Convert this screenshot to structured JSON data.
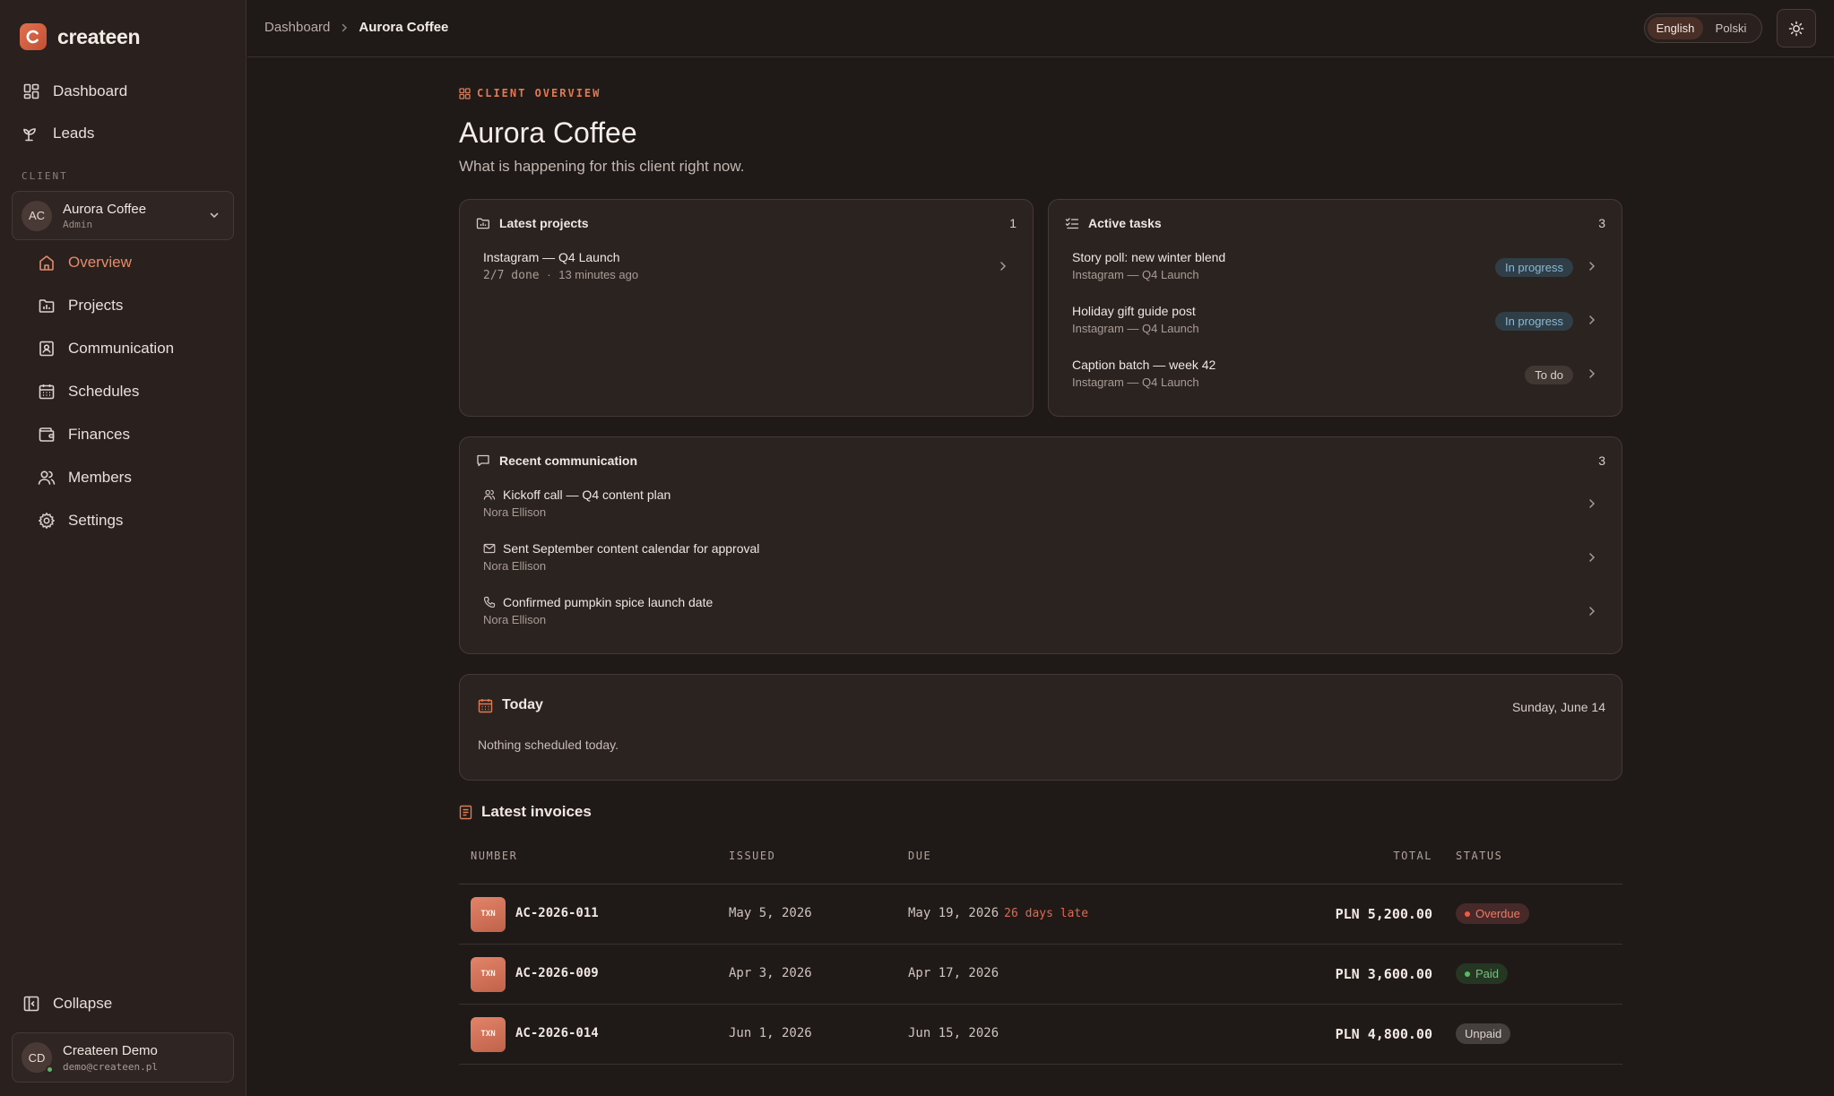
{
  "brand": {
    "name": "createen"
  },
  "nav": {
    "top": [
      {
        "label": "Dashboard",
        "icon": "dashboard-icon"
      },
      {
        "label": "Leads",
        "icon": "sprout-icon"
      }
    ],
    "section_label": "CLIENT",
    "client": {
      "initials": "AC",
      "name": "Aurora Coffee",
      "role": "Admin"
    },
    "sub": [
      {
        "label": "Overview",
        "icon": "home-icon",
        "active": true
      },
      {
        "label": "Projects",
        "icon": "folder-icon"
      },
      {
        "label": "Communication",
        "icon": "contact-icon"
      },
      {
        "label": "Schedules",
        "icon": "calendar-icon"
      },
      {
        "label": "Finances",
        "icon": "wallet-icon"
      },
      {
        "label": "Members",
        "icon": "users-icon"
      },
      {
        "label": "Settings",
        "icon": "gear-icon"
      }
    ],
    "collapse_label": "Collapse",
    "user": {
      "initials": "CD",
      "name": "Createen Demo",
      "email": "demo@createen.pl"
    }
  },
  "topbar": {
    "breadcrumb": [
      "Dashboard",
      "Aurora Coffee"
    ],
    "languages": [
      "English",
      "Polski"
    ],
    "active_language": "English"
  },
  "page": {
    "eyebrow": "CLIENT OVERVIEW",
    "title": "Aurora Coffee",
    "subtitle": "What is happening for this client right now."
  },
  "projects": {
    "title": "Latest projects",
    "count": "1",
    "items": [
      {
        "name": "Instagram — Q4 Launch",
        "progress": "2/7 done",
        "sep": "·",
        "time": "13 minutes ago"
      }
    ]
  },
  "tasks": {
    "title": "Active tasks",
    "count": "3",
    "items": [
      {
        "name": "Story poll: new winter blend",
        "project": "Instagram — Q4 Launch",
        "status": "In progress"
      },
      {
        "name": "Holiday gift guide post",
        "project": "Instagram — Q4 Launch",
        "status": "In progress"
      },
      {
        "name": "Caption batch — week 42",
        "project": "Instagram — Q4 Launch",
        "status": "To do"
      }
    ]
  },
  "communication": {
    "title": "Recent communication",
    "count": "3",
    "items": [
      {
        "icon": "people-icon",
        "title": "Kickoff call — Q4 content plan",
        "person": "Nora Ellison"
      },
      {
        "icon": "mail-icon",
        "title": "Sent September content calendar for approval",
        "person": "Nora Ellison"
      },
      {
        "icon": "phone-icon",
        "title": "Confirmed pumpkin spice launch date",
        "person": "Nora Ellison"
      }
    ]
  },
  "today": {
    "title": "Today",
    "date": "Sunday, June 14",
    "empty": "Nothing scheduled today."
  },
  "invoices": {
    "title": "Latest invoices",
    "columns": {
      "number": "NUMBER",
      "issued": "ISSUED",
      "due": "DUE",
      "total": "TOTAL",
      "status": "STATUS"
    },
    "rows": [
      {
        "tag": "TXN",
        "number": "AC-2026-011",
        "issued": "May 5, 2026",
        "due": "May 19, 2026",
        "late": "26 days late",
        "total": "PLN 5,200.00",
        "status": "Overdue"
      },
      {
        "tag": "TXN",
        "number": "AC-2026-009",
        "issued": "Apr 3, 2026",
        "due": "Apr 17, 2026",
        "late": "",
        "total": "PLN 3,600.00",
        "status": "Paid"
      },
      {
        "tag": "TXN",
        "number": "AC-2026-014",
        "issued": "Jun 1, 2026",
        "due": "Jun 15, 2026",
        "late": "",
        "total": "PLN 4,800.00",
        "status": "Unpaid"
      }
    ]
  },
  "colors": {
    "accent": "#e07a55",
    "background": "#1f1917",
    "sidebar": "#2a211e",
    "card": "#2b2320"
  }
}
